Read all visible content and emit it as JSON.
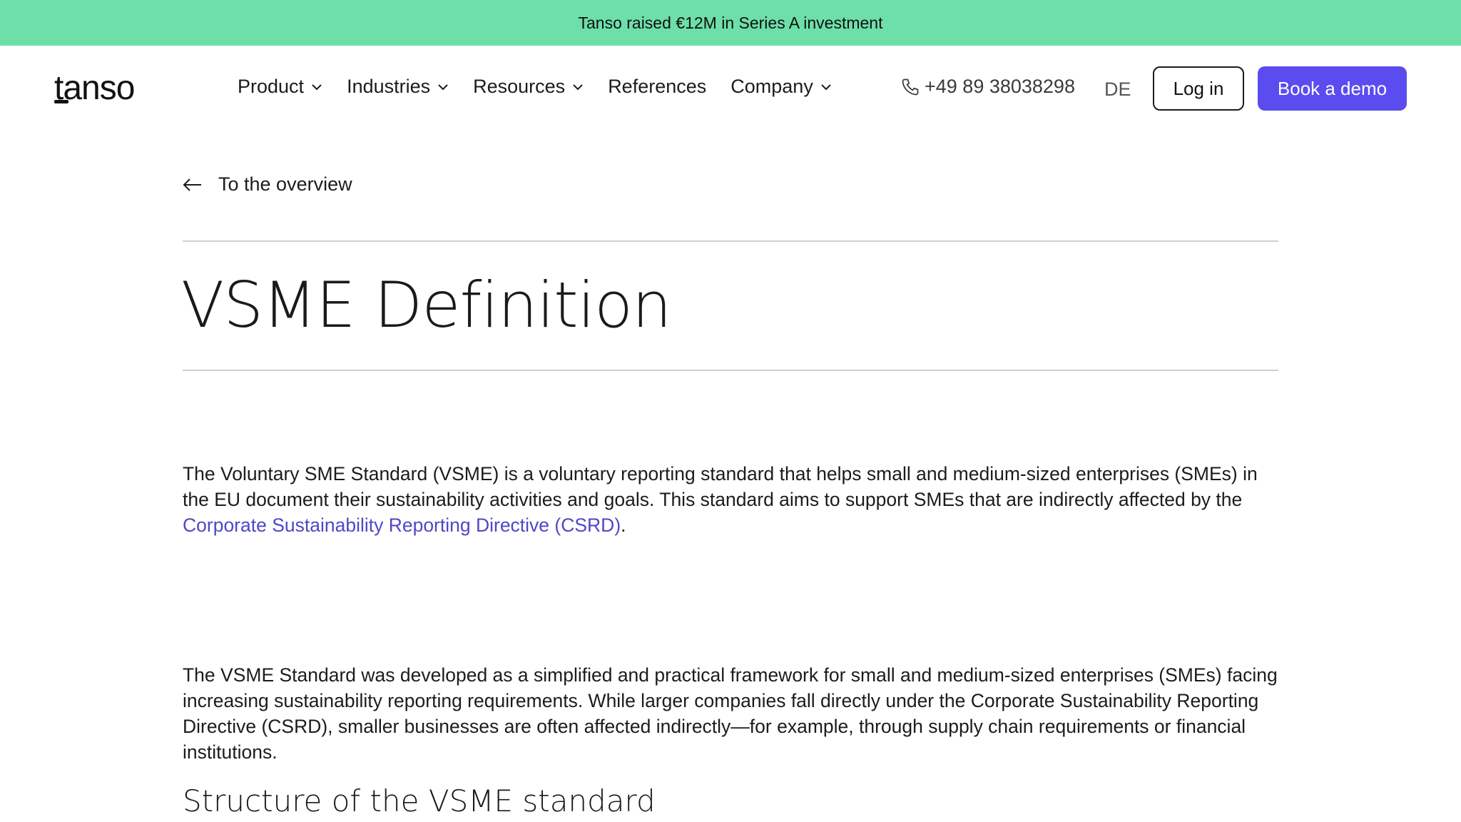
{
  "announcement": {
    "text": "Tanso raised €12M in Series A investment"
  },
  "header": {
    "logo_text": "tanso",
    "nav": [
      {
        "label": "Product",
        "has_dropdown": true
      },
      {
        "label": "Industries",
        "has_dropdown": true
      },
      {
        "label": "Resources",
        "has_dropdown": true
      },
      {
        "label": "References",
        "has_dropdown": false
      },
      {
        "label": "Company",
        "has_dropdown": true
      }
    ],
    "phone": "+49 89 38038298",
    "language": "DE",
    "login_label": "Log in",
    "demo_label": "Book a demo"
  },
  "content": {
    "back_label": "To the overview",
    "title": "VSME Definition",
    "paragraph1": {
      "text_before": "The Voluntary SME Standard (VSME) is a voluntary reporting standard that helps small and medium-sized enterprises (SMEs) in the EU document their sustainability activities and goals. This standard aims to support SMEs that are indirectly affected by the ",
      "link_text": "Corporate Sustainability Reporting Directive (CSRD)",
      "text_after": "."
    },
    "paragraph2": "The VSME Standard was developed as a simplified and practical framework for small and medium-sized enterprises (SMEs) facing increasing sustainability reporting requirements. While larger companies fall directly under the Corporate Sustainability Reporting Directive (CSRD), smaller businesses are often affected indirectly—for example, through supply chain requirements or financial institutions.",
    "section_heading": "Structure of the VSME standard"
  },
  "colors": {
    "announcement_bg": "#6ddfa8",
    "accent": "#5b4cf0",
    "link": "#4f47c7"
  }
}
